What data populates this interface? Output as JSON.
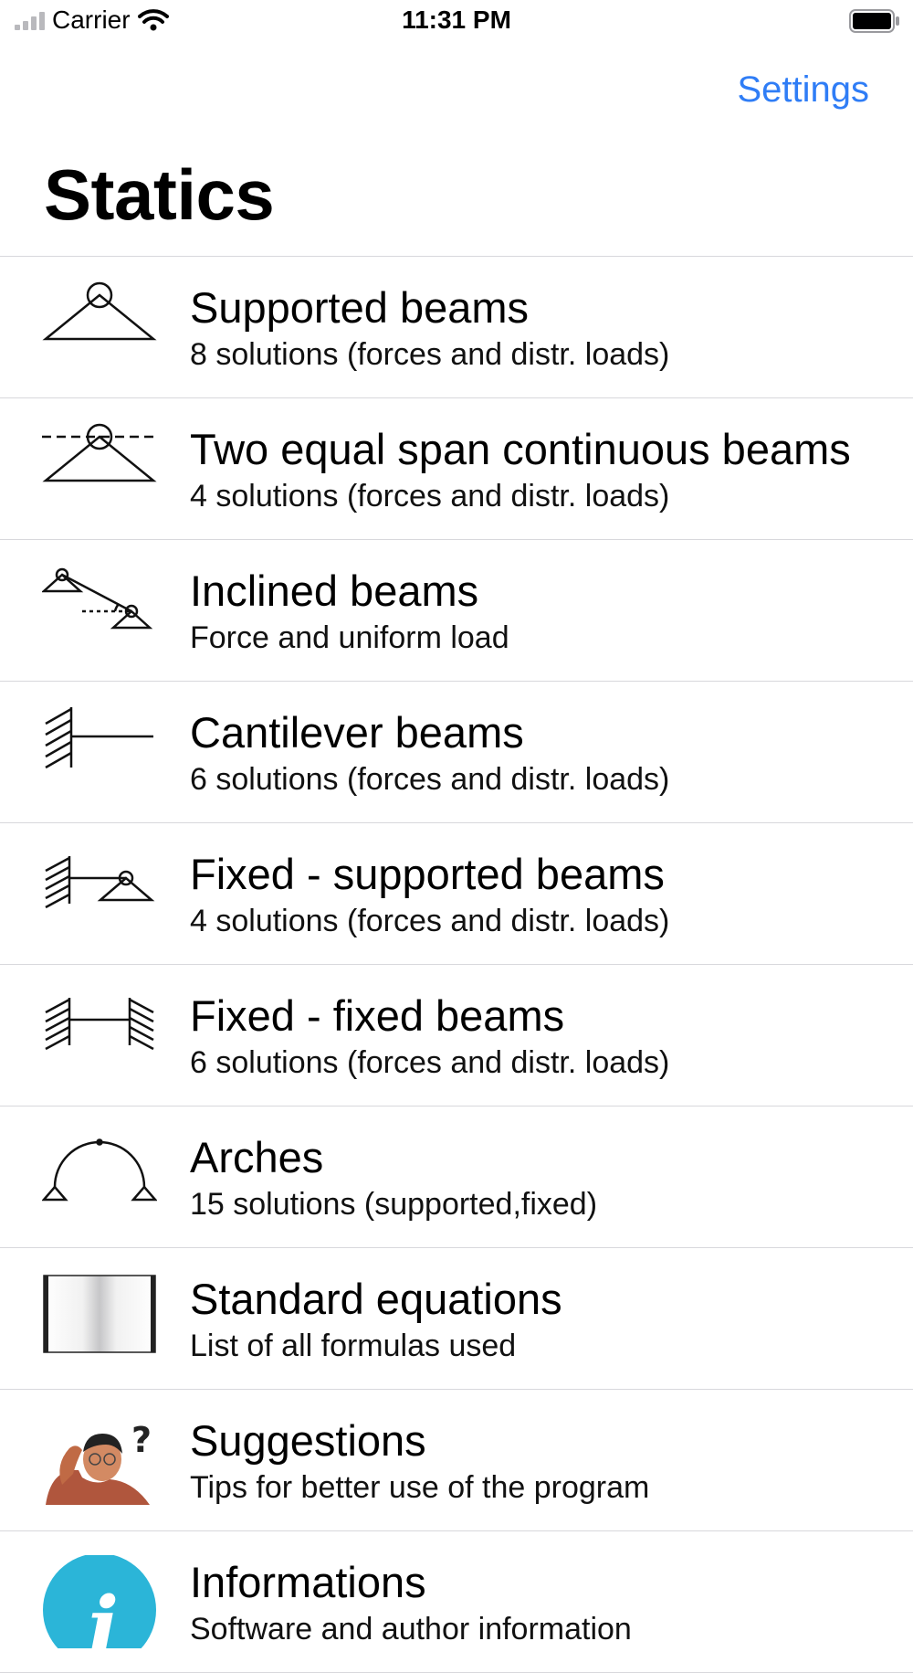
{
  "status_bar": {
    "carrier": "Carrier",
    "time": "11:31 PM"
  },
  "nav": {
    "settings_label": "Settings"
  },
  "page": {
    "title": "Statics"
  },
  "rows": [
    {
      "title": "Supported beams",
      "subtitle": "8 solutions (forces and distr. loads)",
      "icon": "supported-beam-icon"
    },
    {
      "title": "Two equal span continuous beams",
      "subtitle": "4 solutions (forces and distr. loads)",
      "icon": "continuous-beam-icon"
    },
    {
      "title": "Inclined beams",
      "subtitle": "Force and uniform load",
      "icon": "inclined-beam-icon"
    },
    {
      "title": "Cantilever beams",
      "subtitle": "6 solutions (forces and distr. loads)",
      "icon": "cantilever-beam-icon"
    },
    {
      "title": "Fixed - supported beams",
      "subtitle": "4 solutions (forces and distr. loads)",
      "icon": "fixed-supported-beam-icon"
    },
    {
      "title": "Fixed - fixed beams",
      "subtitle": "6 solutions (forces and distr. loads)",
      "icon": "fixed-fixed-beam-icon"
    },
    {
      "title": "Arches",
      "subtitle": "15 solutions (supported,fixed)",
      "icon": "arch-icon"
    },
    {
      "title": "Standard equations",
      "subtitle": "List of all formulas used",
      "icon": "book-icon"
    },
    {
      "title": "Suggestions",
      "subtitle": "Tips for better use of the program",
      "icon": "thinking-person-icon"
    },
    {
      "title": "Informations",
      "subtitle": "Software and author information",
      "icon": "info-icon"
    }
  ],
  "colors": {
    "accent": "#2f7df6",
    "separator": "#d8d8dc",
    "info_icon": "#2bb5d8"
  }
}
